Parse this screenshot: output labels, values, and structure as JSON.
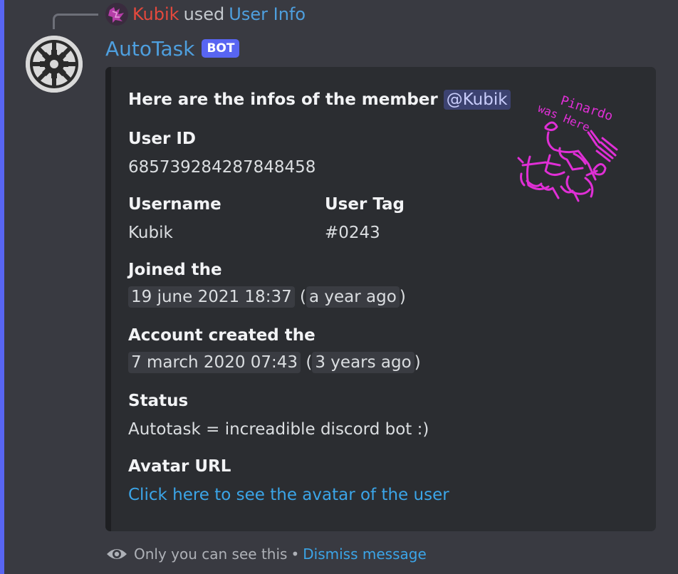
{
  "reply": {
    "user": "Kubik",
    "used": "used",
    "command": "User Info"
  },
  "author": {
    "name": "AutoTask",
    "tag": "BOT"
  },
  "embed": {
    "description": "Here are the infos of the member",
    "mention": "@Kubik",
    "thumbnail_lines": [
      "Pinardo",
      "was Here"
    ],
    "fields": {
      "user_id": {
        "name": "User ID",
        "value": "685739284287848458"
      },
      "username": {
        "name": "Username",
        "value": "Kubik"
      },
      "user_tag": {
        "name": "User Tag",
        "value": "#0243"
      },
      "joined": {
        "name": "Joined the",
        "timestamp": "19 june 2021 18:37",
        "relative": "a year ago"
      },
      "created": {
        "name": "Account created the",
        "timestamp": "7 march 2020 07:43",
        "relative": "3 years ago"
      },
      "status": {
        "name": "Status",
        "value": "Autotask = increadible discord bot :)"
      },
      "avatar": {
        "name": "Avatar URL",
        "link": "Click here to see the avatar of the user"
      }
    }
  },
  "footer": {
    "text": "Only you can see this",
    "separator": "•",
    "dismiss": "Dismiss message"
  },
  "colors": {
    "accent": "#5865f2",
    "author": "#4e9fde",
    "reply_user": "#e5493d",
    "link": "#3ba5e8",
    "thumbnail_ink": "#e02fd6"
  },
  "icons": {
    "bot_avatar": "gear-icon",
    "footer": "eye-icon"
  }
}
